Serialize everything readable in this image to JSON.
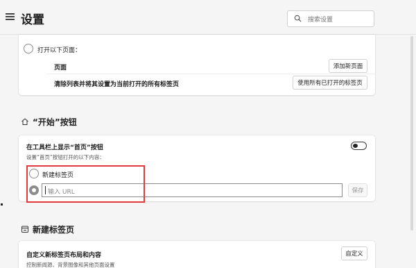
{
  "header": {
    "title": "设置",
    "search_placeholder": "搜索设置"
  },
  "startup": {
    "open_pages_label": "打开以下页面：",
    "pages_label": "页面",
    "add_page_button": "添加新页面",
    "clear_list_label": "清除列表并将其设置为当前打开的所有标签页",
    "use_open_tabs_button": "使用所有已打开的标签页"
  },
  "home_button": {
    "section_title": "“开始”按钮",
    "show_label": "在工具栏上显示“首页”按钮",
    "description": "设置“首页”按钮打开的以下内容：",
    "toggle_on": false,
    "option_new_tab": "新建标签页",
    "url_placeholder": "输入 URL",
    "save_button": "保存"
  },
  "new_tab": {
    "section_title": "新建标签页",
    "customize_label": "自定义新标签页布局和内容",
    "customize_description": "控制新闻源、背景图像和其他页面设置",
    "customize_button": "自定义"
  },
  "colors": {
    "highlight": "#e0393e",
    "background": "#f5f5f5",
    "card": "#ffffff"
  }
}
